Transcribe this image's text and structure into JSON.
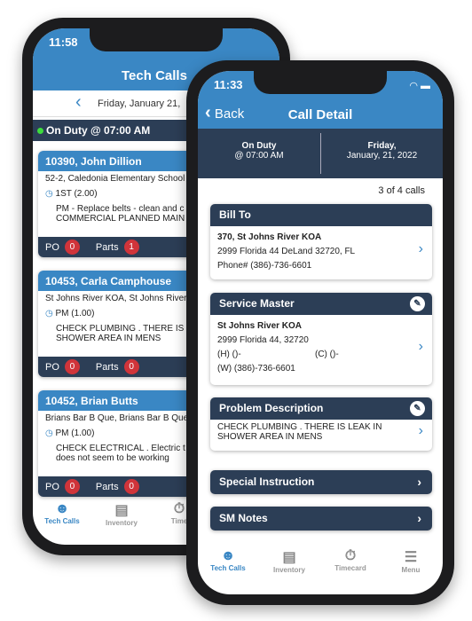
{
  "back_phone": {
    "status_time": "11:58",
    "title": "Tech Calls",
    "date": "Friday, January 21,",
    "duty": "On Duty @ 07:00 AM",
    "calls": [
      {
        "title": "10390, John Dillion",
        "location": "52-2, Caledonia Elementary School",
        "shift": "1ST (2.00)",
        "desc1": "PM - Replace belts - clean and c",
        "desc2": "COMMERCIAL PLANNED MAIN",
        "po_label": "PO",
        "po": "0",
        "parts_label": "Parts",
        "parts": "1"
      },
      {
        "title": "10453, Carla Camphouse",
        "location": "St Johns River KOA, St Johns River",
        "shift": "PM (1.00)",
        "desc1": "CHECK PLUMBING . THERE IS",
        "desc2": "SHOWER AREA IN MENS",
        "po_label": "PO",
        "po": "0",
        "parts_label": "Parts",
        "parts": "0"
      },
      {
        "title": "10452, Brian Butts",
        "location": "Brians Bar B Que, Brians Bar B Que",
        "shift": "PM (1.00)",
        "desc1": "CHECK ELECTRICAL . Electric t",
        "desc2": "does not seem to be working",
        "po_label": "PO",
        "po": "0",
        "parts_label": "Parts",
        "parts": "0"
      }
    ],
    "tabs": [
      "Tech Calls",
      "Inventory",
      "Time"
    ]
  },
  "front_phone": {
    "status_time": "11:33",
    "back_label": "Back",
    "title": "Call Detail",
    "duty_line1": "On Duty",
    "duty_line2": "@ 07:00 AM",
    "date_line1": "Friday,",
    "date_line2": "January, 21, 2022",
    "call_count": "3 of 4 calls",
    "bill_to": {
      "header": "Bill To",
      "line1": "370, St Johns River KOA",
      "line2": "2999 Florida 44 DeLand 32720, FL",
      "line3": "Phone# (386)-736-6601"
    },
    "service_master": {
      "header": "Service Master",
      "line1": "St Johns River KOA",
      "line2": "2999 Florida 44, 32720",
      "home": "(H) ()-",
      "cell": "(C) ()-",
      "work": "(W) (386)-736-6601"
    },
    "problem": {
      "header": "Problem Description",
      "line1": "CHECK PLUMBING . THERE IS  LEAK IN",
      "line2": "SHOWER AREA IN MENS"
    },
    "special_instruction": "Special Instruction",
    "sm_notes": "SM Notes",
    "tabs": [
      "Tech Calls",
      "Inventory",
      "Timecard",
      "Menu"
    ]
  },
  "colors": {
    "header_blue": "#3a87c4",
    "navy": "#2c3e56",
    "badge_red": "#d0343a",
    "on_duty_green": "#3ddc3d"
  }
}
